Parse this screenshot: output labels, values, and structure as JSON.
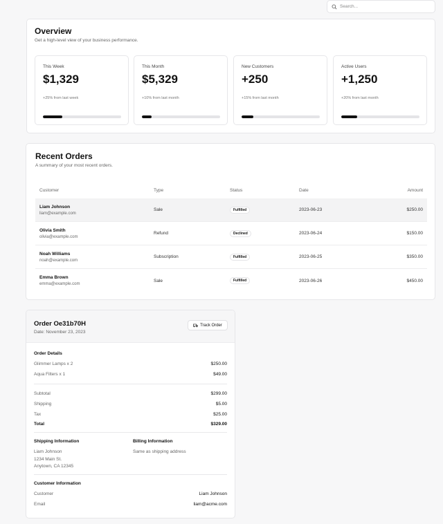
{
  "search": {
    "placeholder": "Search..."
  },
  "overview": {
    "title": "Overview",
    "subtitle": "Get a high-level view of your business performance.",
    "stats": [
      {
        "label": "This Week",
        "value": "$1,329",
        "change": "+25% from last week",
        "progress": 0.25
      },
      {
        "label": "This Month",
        "value": "$5,329",
        "change": "+10% from last month",
        "progress": 0.12
      },
      {
        "label": "New Customers",
        "value": "+250",
        "change": "+15% from last month",
        "progress": 0.15
      },
      {
        "label": "Active Users",
        "value": "+1,250",
        "change": "+20% from last month",
        "progress": 0.2
      }
    ]
  },
  "orders": {
    "title": "Recent Orders",
    "subtitle": "A summary of your most recent orders.",
    "columns": [
      "Customer",
      "Type",
      "Status",
      "Date",
      "Amount"
    ],
    "rows": [
      {
        "name": "Liam Johnson",
        "email": "liam@example.com",
        "type": "Sale",
        "status": "Fulfilled",
        "date": "2023-06-23",
        "amount": "$250.00"
      },
      {
        "name": "Olivia Smith",
        "email": "olivia@example.com",
        "type": "Refund",
        "status": "Declined",
        "date": "2023-06-24",
        "amount": "$150.00"
      },
      {
        "name": "Noah Williams",
        "email": "noah@example.com",
        "type": "Subscription",
        "status": "Fulfilled",
        "date": "2023-06-25",
        "amount": "$350.00"
      },
      {
        "name": "Emma Brown",
        "email": "emma@example.com",
        "type": "Sale",
        "status": "Fulfilled",
        "date": "2023-06-26",
        "amount": "$450.00"
      }
    ]
  },
  "order_detail": {
    "title": "Order Oe31b70H",
    "date": "Date: November 23, 2023",
    "track_label": "Track Order",
    "details_heading": "Order Details",
    "items": [
      {
        "label": "Glimmer Lamps x 2",
        "value": "$250.00"
      },
      {
        "label": "Aqua Filters x 1",
        "value": "$49.00"
      }
    ],
    "subtotal": {
      "label": "Subtotal",
      "value": "$299.00"
    },
    "shipping": {
      "label": "Shipping",
      "value": "$5.00"
    },
    "tax": {
      "label": "Tax",
      "value": "$25.00"
    },
    "total": {
      "label": "Total",
      "value": "$329.00"
    },
    "shipping_heading": "Shipping Information",
    "shipping_address": [
      "Liam Johnson",
      "1234 Main St.",
      "Anytown, CA 12345"
    ],
    "billing_heading": "Billing Information",
    "billing_text": "Same as shipping address",
    "customer_heading": "Customer Information",
    "customer": {
      "label": "Customer",
      "value": "Liam Johnson"
    },
    "email": {
      "label": "Email",
      "value": "liam@acme.com"
    }
  }
}
